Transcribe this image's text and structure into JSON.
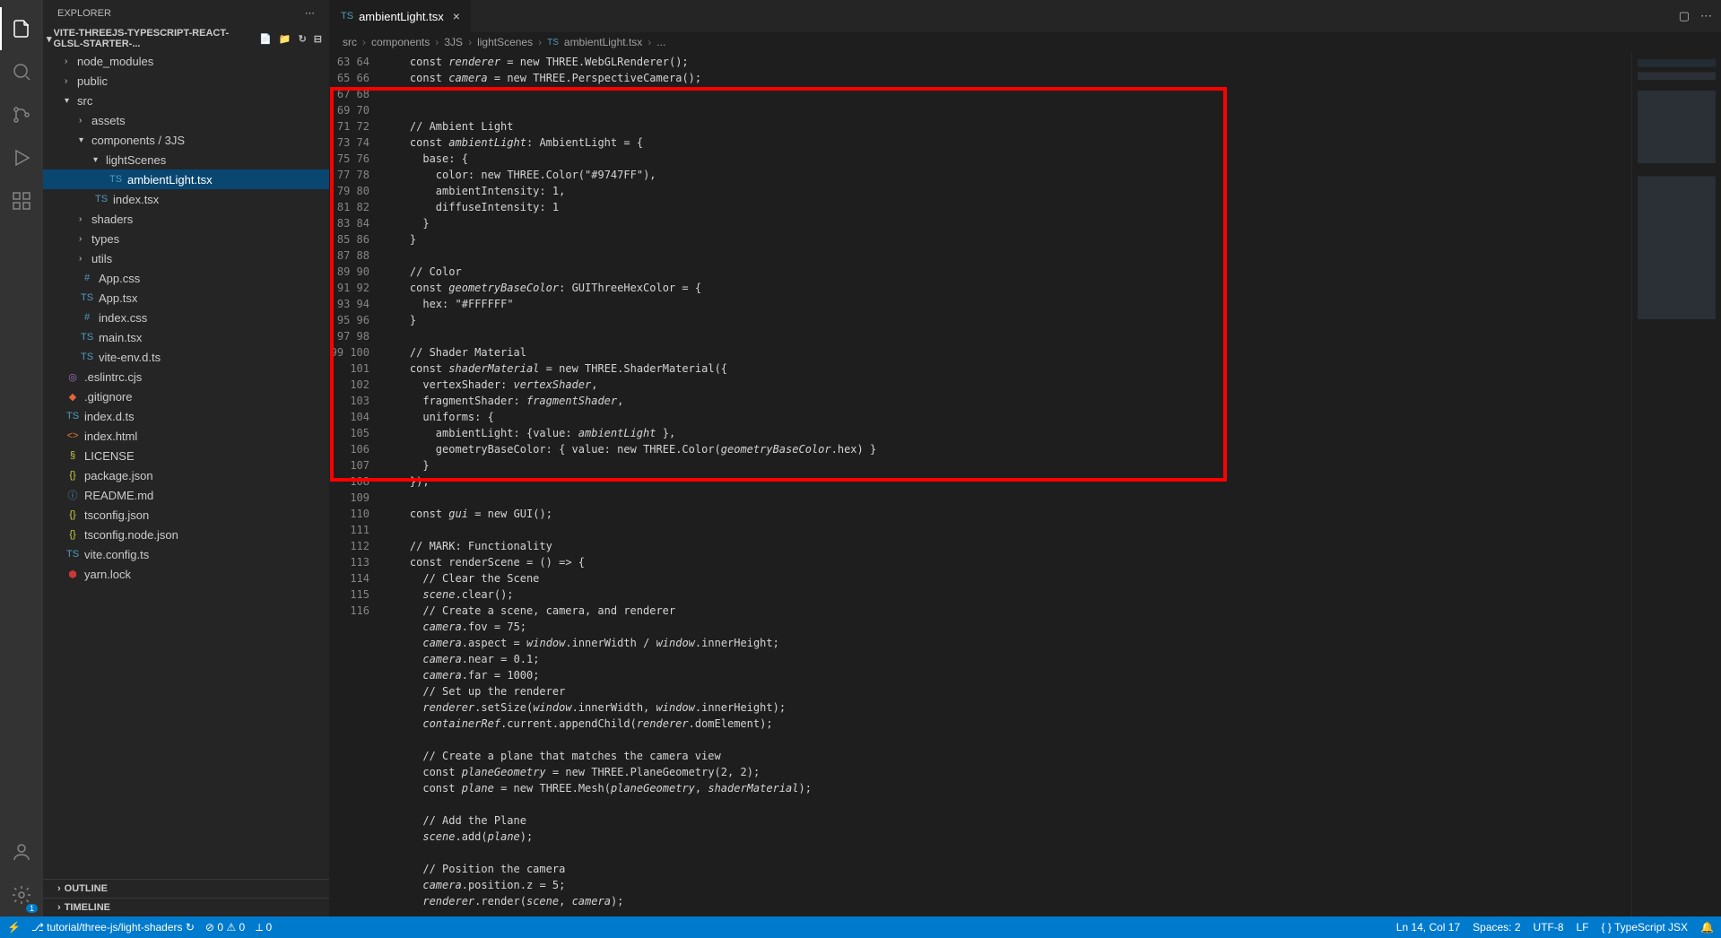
{
  "sidebar": {
    "title": "EXPLORER",
    "project": "VITE-THREEJS-TYPESCRIPT-REACT-GLSL-STARTER-...",
    "outline": "OUTLINE",
    "timeline": "TIMELINE"
  },
  "tree": {
    "node_modules": "node_modules",
    "public": "public",
    "src": "src",
    "assets": "assets",
    "components_3js": "components / 3JS",
    "lightScenes": "lightScenes",
    "ambientLight": "ambientLight.tsx",
    "index_tsx": "index.tsx",
    "shaders": "shaders",
    "types": "types",
    "utils": "utils",
    "app_css": "App.css",
    "app_tsx": "App.tsx",
    "index_css": "index.css",
    "main_tsx": "main.tsx",
    "vite_env": "vite-env.d.ts",
    "eslintrc": ".eslintrc.cjs",
    "gitignore": ".gitignore",
    "index_d_ts": "index.d.ts",
    "index_html": "index.html",
    "license": "LICENSE",
    "package_json": "package.json",
    "readme": "README.md",
    "tsconfig": "tsconfig.json",
    "tsconfig_node": "tsconfig.node.json",
    "vite_config": "vite.config.ts",
    "yarn_lock": "yarn.lock"
  },
  "tab": {
    "icon": "TS",
    "name": "ambientLight.tsx"
  },
  "breadcrumbs": [
    "src",
    "components",
    "3JS",
    "lightScenes",
    "ambientLight.tsx",
    "..."
  ],
  "code": {
    "start": 63,
    "lines": [
      "    <kw>const</kw> <var>renderer</var> <pun>=</pun> <kw>new</kw> <cls>THREE</cls><pun>.</pun><fn>WebGLRenderer</fn><pun>();</pun>",
      "    <kw>const</kw> <var>camera</var> <pun>=</pun> <kw>new</kw> <cls>THREE</cls><pun>.</pun><fn>PerspectiveCamera</fn><pun>();</pun>",
      "",
      "",
      "    <cmt>// Ambient Light</cmt>",
      "    <kw>const</kw> <var>ambientLight</var><pun>:</pun> <cls>AmbientLight</cls> <pun>= {</pun>",
      "      <prop>base</prop><pun>: {</pun>",
      "        <prop>color</prop><pun>:</pun> <kw>new</kw> <cls>THREE</cls><pun>.</pun><fn>Color</fn><pun>(</pun><str>\"#9747FF\"</str><pun>),</pun>",
      "        <prop>ambientIntensity</prop><pun>:</pun> <num>1</num><pun>,</pun>",
      "        <prop>diffuseIntensity</prop><pun>:</pun> <num>1</num>",
      "      <pun>}</pun>",
      "    <pun>}</pun>",
      "",
      "    <cmt>// Color</cmt>",
      "    <kw>const</kw> <var>geometryBaseColor</var><pun>:</pun> <cls>GUIThreeHexColor</cls> <pun>= {</pun>",
      "      <prop>hex</prop><pun>:</pun> <str>\"#FFFFFF\"</str>",
      "    <pun>}</pun>",
      "",
      "    <cmt>// Shader Material</cmt>",
      "    <kw>const</kw> <var>shaderMaterial</var> <pun>=</pun> <kw>new</kw> <cls>THREE</cls><pun>.</pun><fn>ShaderMaterial</fn><pun>({</pun>",
      "      <prop>vertexShader</prop><pun>:</pun> <var>vertexShader</var><pun>,</pun>",
      "      <prop>fragmentShader</prop><pun>:</pun> <var>fragmentShader</var><pun>,</pun>",
      "      <prop>uniforms</prop><pun>: {</pun>",
      "        <prop>ambientLight</prop><pun>: {</pun><prop>value</prop><pun>:</pun> <var>ambientLight</var> <pun>},</pun>",
      "        <prop>geometryBaseColor</prop><pun>: {</pun> <prop>value</prop><pun>:</pun> <kw>new</kw> <cls>THREE</cls><pun>.</pun><fn>Color</fn><pun>(</pun><var>geometryBaseColor</var><pun>.</pun><prop>hex</prop><pun>) }</pun>",
      "      <pun>}</pun>",
      "    <pun>});</pun>",
      "",
      "    <kw>const</kw> <var>gui</var> <pun>=</pun> <kw>new</kw> <fn>GUI</fn><pun>();</pun>",
      "",
      "    <cmt>// MARK: Functionality</cmt>",
      "    <kw>const</kw> <fn>renderScene</fn> <pun>= () </pun><kw>=&gt;</kw><pun> {</pun>",
      "      <cmt>// Clear the Scene</cmt>",
      "      <var>scene</var><pun>.</pun><fn>clear</fn><pun>();</pun>",
      "      <cmt>// Create a scene, camera, and renderer</cmt>",
      "      <var>camera</var><pun>.</pun><prop>fov</prop> <pun>=</pun> <num>75</num><pun>;</pun>",
      "      <var>camera</var><pun>.</pun><prop>aspect</prop> <pun>=</pun> <var>window</var><pun>.</pun><prop>innerWidth</prop> <pun>/</pun> <var>window</var><pun>.</pun><prop>innerHeight</prop><pun>;</pun>",
      "      <var>camera</var><pun>.</pun><prop>near</prop> <pun>=</pun> <num>0.1</num><pun>;</pun>",
      "      <var>camera</var><pun>.</pun><prop>far</prop> <pun>=</pun> <num>1000</num><pun>;</pun>",
      "      <cmt>// Set up the renderer</cmt>",
      "      <var>renderer</var><pun>.</pun><fn>setSize</fn><pun>(</pun><var>window</var><pun>.</pun><prop>innerWidth</prop><pun>,</pun> <var>window</var><pun>.</pun><prop>innerHeight</prop><pun>);</pun>",
      "      <var>containerRef</var><pun>.</pun><prop>current</prop><pun>.</pun><fn>appendChild</fn><pun>(</pun><var>renderer</var><pun>.</pun><prop>domElement</prop><pun>);</pun>",
      "",
      "      <cmt>// Create a plane that matches the camera view</cmt>",
      "      <kw>const</kw> <var>planeGeometry</var> <pun>=</pun> <kw>new</kw> <cls>THREE</cls><pun>.</pun><fn>PlaneGeometry</fn><pun>(</pun><num>2</num><pun>,</pun> <num>2</num><pun>);</pun>",
      "      <kw>const</kw> <var>plane</var> <pun>=</pun> <kw>new</kw> <cls>THREE</cls><pun>.</pun><fn>Mesh</fn><pun>(</pun><var>planeGeometry</var><pun>,</pun> <var>shaderMaterial</var><pun>);</pun>",
      "",
      "      <cmt>// Add the Plane</cmt>",
      "      <var>scene</var><pun>.</pun><fn>add</fn><pun>(</pun><var>plane</var><pun>);</pun>",
      "",
      "      <cmt>// Position the camera</cmt>",
      "      <var>camera</var><pun>.</pun><prop>position</prop><pun>.</pun><prop>z</prop> <pun>=</pun> <num>5</num><pun>;</pun>",
      "      <var>renderer</var><pun>.</pun><fn>render</fn><pun>(</pun><var>scene</var><pun>,</pun> <var>camera</var><pun>);</pun>",
      ""
    ]
  },
  "status": {
    "branch": "tutorial/three-js/light-shaders",
    "errors": "0",
    "warnings": "0",
    "ports": "0",
    "lncol": "Ln 14, Col 17",
    "spaces": "Spaces: 2",
    "encoding": "UTF-8",
    "eol": "LF",
    "lang": "TypeScript JSX"
  }
}
